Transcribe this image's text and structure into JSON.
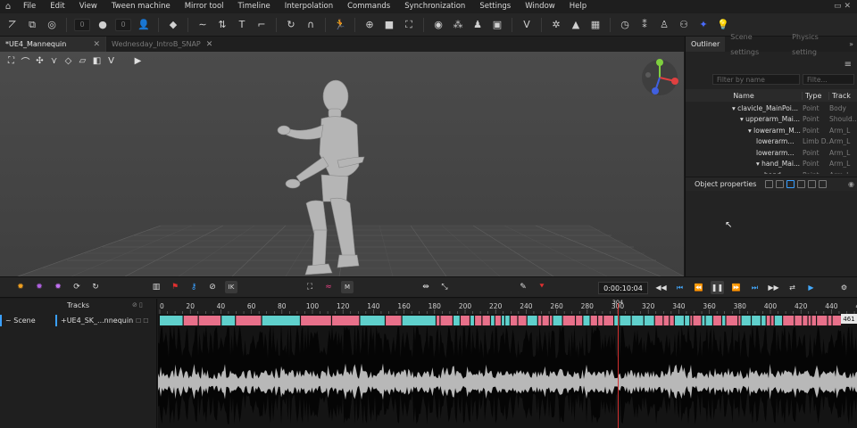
{
  "menu": {
    "items": [
      "File",
      "Edit",
      "View",
      "Tween machine",
      "Mirror tool",
      "Timeline",
      "Interpolation",
      "Commands",
      "Synchronization",
      "Settings",
      "Window",
      "Help"
    ],
    "icons": [
      "home-icon",
      "window-split-icon",
      "window-close-icon"
    ]
  },
  "toolbar": {
    "fields": [
      "0",
      "0",
      "0"
    ]
  },
  "tabs": {
    "active": "*UE4_Mannequin",
    "inactive": "Wednesday_IntroB_SNAP",
    "close": "✕"
  },
  "right_panel": {
    "tabs": [
      "Outliner",
      "Scene settings",
      "Physics setting"
    ],
    "filter_name_placeholder": "Filter by name",
    "filter_type_placeholder": "Filte...",
    "columns": [
      "Name",
      "Type",
      "Track"
    ],
    "tree": [
      {
        "name": "▾ clavicle_MainPoi...",
        "type": "Point",
        "track": "Body",
        "indent": 0
      },
      {
        "name": "▾ upperarm_Mai...",
        "type": "Point",
        "track": "Should...",
        "indent": 1
      },
      {
        "name": "▾ lowerarm_M...",
        "type": "Point",
        "track": "Arm_L",
        "indent": 2
      },
      {
        "name": "lowerarm...",
        "type": "Limb D...",
        "track": "Arm_L",
        "indent": 3
      },
      {
        "name": "lowerarm...",
        "type": "Point",
        "track": "Arm_L",
        "indent": 3
      },
      {
        "name": "▾ hand_Mai...",
        "type": "Point",
        "track": "Arm_L",
        "indent": 3
      },
      {
        "name": "hand...",
        "type": "Point",
        "track": "Arm_L",
        "indent": 4
      }
    ],
    "object_properties": "Object properties"
  },
  "timeline": {
    "timecode": "0:00:10:04",
    "tracks_label": "Tracks",
    "scene_label": "Scene",
    "model_label": "UE4_SK_...nnequin",
    "playhead_frame": "304",
    "end_frame": "461",
    "ruler_ticks": [
      "0",
      "20",
      "40",
      "60",
      "80",
      "100",
      "120",
      "140",
      "160",
      "180",
      "200",
      "220",
      "240",
      "260",
      "280",
      "300",
      "320",
      "340",
      "360",
      "380",
      "400",
      "420",
      "440",
      "460"
    ],
    "tool_labels": [
      "IK",
      "M"
    ]
  },
  "colors": {
    "key_pink": "#e8708a",
    "key_cyan": "#5fd0cc",
    "playhead": "#d43030",
    "accent_blue": "#3aa0ff"
  }
}
